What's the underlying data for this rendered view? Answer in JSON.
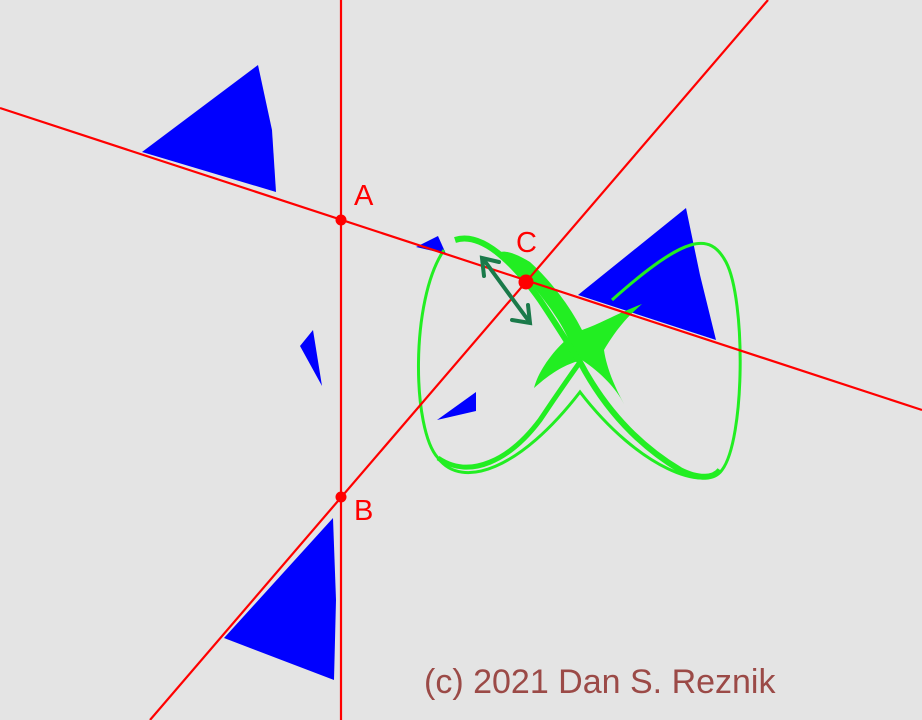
{
  "labels": {
    "a": "A",
    "b": "B",
    "c": "C"
  },
  "credit": "(c) 2021 Dan S. Reznik",
  "colors": {
    "background": "#e4e4e4",
    "lines": "#ff0000",
    "triangles": "#0000ff",
    "curve": "#22ee22",
    "arrow": "#1a7a4a",
    "credit": "#9b4a47"
  }
}
